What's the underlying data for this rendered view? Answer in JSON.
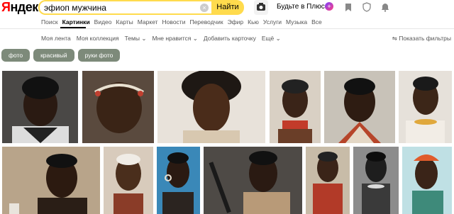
{
  "header": {
    "logo_red": "Я",
    "logo_black": "ндекс",
    "search_value": "эфиоп мужчина",
    "find_label": "Найти",
    "plus_label": "Будьте в Плюсе"
  },
  "tabs": [
    "Поиск",
    "Картинки",
    "Видео",
    "Карты",
    "Маркет",
    "Новости",
    "Переводчик",
    "Эфир",
    "Кью",
    "Услуги",
    "Музыка",
    "Все"
  ],
  "subnav": {
    "items": [
      "Моя лента",
      "Моя коллекция",
      "Темы ⌄",
      "Мне нравится ⌄",
      "Добавить карточку",
      "Ещё ⌄"
    ],
    "filters_label": "Показать фильтры"
  },
  "chips": [
    "фото",
    "красивый",
    "руки фото"
  ],
  "colors": {
    "accent": "#ffdb4d",
    "chip": "#7d8a7a"
  }
}
